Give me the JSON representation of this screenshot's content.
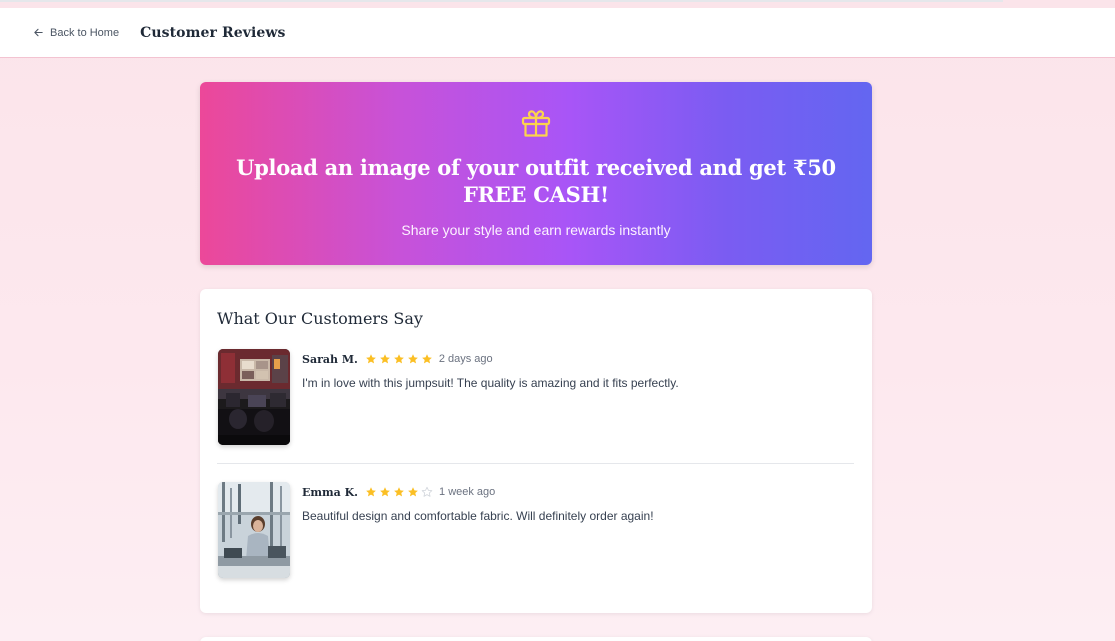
{
  "header": {
    "back_label": "Back to Home",
    "title": "Customer Reviews"
  },
  "promo": {
    "icon": "gift-icon",
    "title": "Upload an image of your outfit received and get ₹50 FREE CASH!",
    "subtitle": "Share your style and earn rewards instantly"
  },
  "reviews": {
    "title": "What Our Customers Say",
    "items": [
      {
        "name": "Sarah M.",
        "rating": 5,
        "max_rating": 5,
        "date": "2 days ago",
        "text": "I'm in love with this jumpsuit! The quality is amazing and it fits perfectly.",
        "photo": "office-workstation-photo"
      },
      {
        "name": "Emma K.",
        "rating": 4,
        "max_rating": 5,
        "date": "1 week ago",
        "text": "Beautiful design and comfortable fabric. Will definitely order again!",
        "photo": "lab-worker-photo"
      }
    ]
  },
  "colors": {
    "star_filled": "#fbbf24",
    "star_empty": "#d1d5db",
    "promo_start": "#ec4899",
    "promo_mid": "#a855f7",
    "promo_end": "#6366f1",
    "gift_icon": "#fcd34d"
  }
}
